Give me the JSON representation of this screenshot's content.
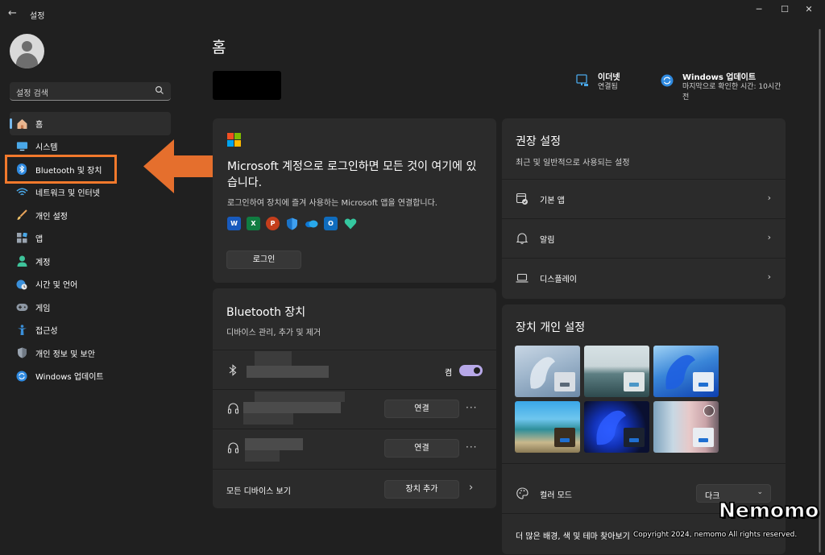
{
  "window": {
    "title": "설정",
    "back_glyph": "←",
    "minimize_glyph": "─",
    "maximize_glyph": "☐",
    "close_glyph": "✕"
  },
  "search": {
    "placeholder": "설정 검색",
    "icon": "search-icon"
  },
  "sidebar": {
    "items": [
      {
        "label": "홈",
        "icon": "home-icon",
        "active": true
      },
      {
        "label": "시스템",
        "icon": "monitor-icon"
      },
      {
        "label": "Bluetooth 및 장치",
        "icon": "bluetooth-icon"
      },
      {
        "label": "네트워크 및 인터넷",
        "icon": "wifi-icon"
      },
      {
        "label": "개인 설정",
        "icon": "brush-icon"
      },
      {
        "label": "앱",
        "icon": "apps-icon"
      },
      {
        "label": "계정",
        "icon": "person-icon"
      },
      {
        "label": "시간 및 언어",
        "icon": "globe-clock-icon"
      },
      {
        "label": "게임",
        "icon": "gamepad-icon"
      },
      {
        "label": "접근성",
        "icon": "accessibility-icon"
      },
      {
        "label": "개인 정보 및 보안",
        "icon": "shield-icon"
      },
      {
        "label": "Windows 업데이트",
        "icon": "update-icon"
      }
    ]
  },
  "main": {
    "page_title": "홈",
    "status": {
      "ethernet": {
        "title": "이더넷",
        "detail": "연결됨",
        "icon": "ethernet-icon"
      },
      "update": {
        "title": "Windows 업데이트",
        "detail_line1": "마지막으로 확인한 시간: 10시간",
        "detail_line2": "전",
        "icon": "sync-icon"
      }
    },
    "ms_card": {
      "heading": "Microsoft 계정으로 로그인하면 모든 것이 여기에 있습니다.",
      "subtitle": "로그인하여 장치에 즐겨 사용하는 Microsoft 앱을 연결합니다.",
      "apps": [
        {
          "icon": "word-icon",
          "letter": "W",
          "color": "#185abd"
        },
        {
          "icon": "excel-icon",
          "letter": "X",
          "color": "#107c41"
        },
        {
          "icon": "powerpoint-icon",
          "letter": "P",
          "color": "#c43e1c"
        },
        {
          "icon": "defender-icon",
          "letter": "",
          "color": "#1a73c8"
        },
        {
          "icon": "onedrive-icon",
          "letter": "",
          "color": "#2b2b2b"
        },
        {
          "icon": "outlook-icon",
          "letter": "O",
          "color": "#0f6cbd"
        },
        {
          "icon": "family-icon",
          "letter": "",
          "color": "#2b2b2b"
        }
      ],
      "login_label": "로그인"
    },
    "bt_card": {
      "title": "Bluetooth 장치",
      "subtitle": "디바이스 관리, 추가 및 제거",
      "bt_state": "켬",
      "connect_label": "연결",
      "more_glyph": "···",
      "view_all_label": "모든 디바이스 보기",
      "add_device_label": "장치 추가",
      "chevron": "›"
    },
    "rec_card": {
      "title": "권장 설정",
      "subtitle": "최근 및 일반적으로 사용되는 설정",
      "items": [
        {
          "label": "기본 앱",
          "icon": "default-apps-icon"
        },
        {
          "label": "알림",
          "icon": "bell-icon"
        },
        {
          "label": "디스플레이",
          "icon": "laptop-icon"
        }
      ],
      "chevron": "›"
    },
    "device_card": {
      "title": "장치 개인 설정",
      "color_mode_label": "컬러 모드",
      "color_mode_value": "다크",
      "select_chevron": "⌄",
      "more_label": "더 많은 배경, 색 및 테마 찾아보기"
    }
  },
  "annotation": {
    "box_color": "#f2792c"
  },
  "watermark": {
    "brand": "Nemomo",
    "copyright": "Copyright 2024, nemomo All rights reserved."
  },
  "colors": {
    "accent": "#76b9ed",
    "toggle": "#b7a8e8",
    "background": "#202020",
    "card": "#2b2b2b"
  }
}
